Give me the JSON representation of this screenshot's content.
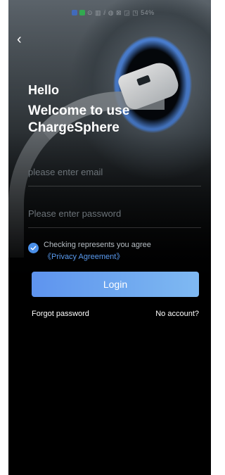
{
  "app": {
    "brand_color": "#4a8fe8",
    "background_color": "#000000"
  },
  "status_bar": {
    "indicators_text": "⊙ ▥ ⅈ ◍ ⊠ ◲ ◳ 54%"
  },
  "header": {
    "back_icon": "chevron-left-icon",
    "back_glyph": "‹"
  },
  "greeting": {
    "hello": "Hello",
    "welcome": "Welcome to use ChargeSphere"
  },
  "form": {
    "email_placeholder": "please enter email",
    "email_value": "",
    "password_placeholder": "Please enter password",
    "password_value": "",
    "agreement": {
      "checked": true,
      "text": "Checking represents you agree",
      "link": "《Privacy Agreement》"
    },
    "login_label": "Login"
  },
  "footer_links": {
    "forgot_password": "Forgot password",
    "no_account": "No account?"
  }
}
